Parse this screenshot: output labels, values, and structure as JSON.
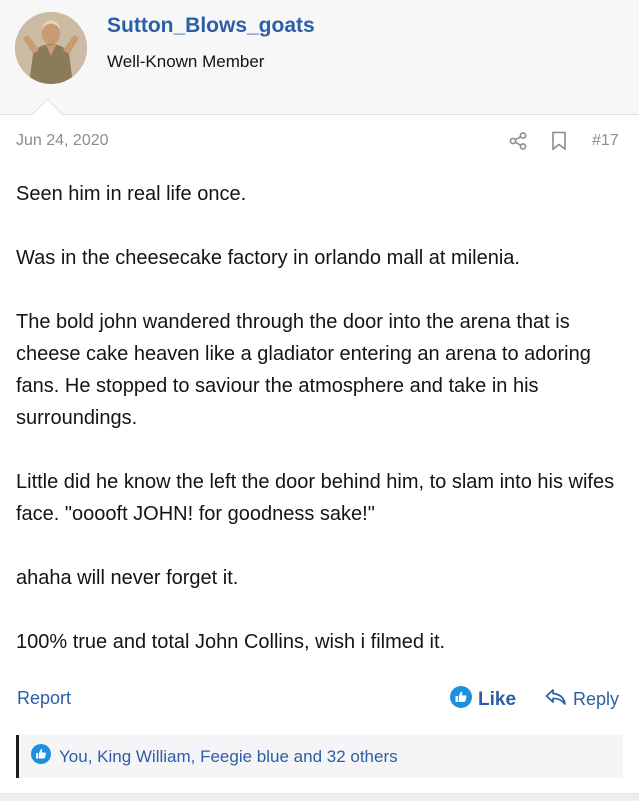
{
  "user": {
    "name": "Sutton_Blows_goats",
    "title": "Well-Known Member"
  },
  "post": {
    "date": "Jun 24, 2020",
    "number": "#17",
    "paragraphs": [
      "Seen him in real life once.",
      "Was in the cheesecake factory in orlando mall at milenia.",
      "The bold john wandered through the door into the arena that is cheese cake heaven like a gladiator entering an arena to adoring fans. He stopped to saviour the atmosphere and take in his surroundings.",
      "Little did he know the left the door behind him, to slam into his wifes face. \"ooooft JOHN! for goodness sake!\"",
      "ahaha will never forget it.",
      "100% true and total John Collins, wish i filmed it."
    ]
  },
  "actions": {
    "report": "Report",
    "like": "Like",
    "reply": "Reply"
  },
  "reactions": {
    "text": "You, King William, Feegie blue and 32 others"
  },
  "colors": {
    "link": "#2b5ea6",
    "like_icon": "#1d8fe1"
  },
  "icons": [
    "share-icon",
    "bookmark-icon",
    "thumbs-up-icon",
    "reply-icon"
  ]
}
